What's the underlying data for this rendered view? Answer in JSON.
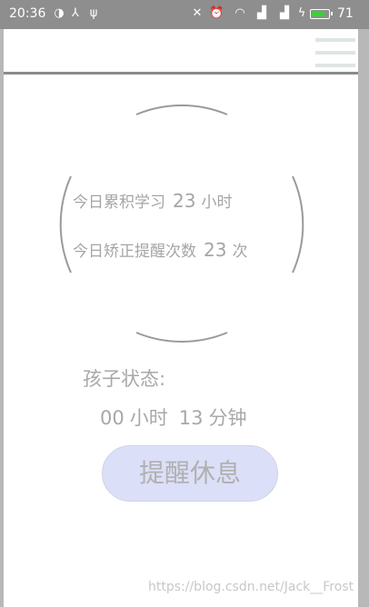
{
  "status_bar": {
    "time": "20:36",
    "battery_level": "71",
    "battery_color": "#38d236"
  },
  "app_bar": {
    "menu_icon": "hamburger-menu-icon"
  },
  "stats": {
    "study_label": "今日累积学习",
    "study_value": "23",
    "study_unit": "小时",
    "correct_label": "今日矫正提醒次数",
    "correct_value": "23",
    "correct_unit": "次"
  },
  "child_status": {
    "label": "孩子状态:",
    "hours": "00",
    "hours_unit": "小时",
    "minutes": "13",
    "minutes_unit": "分钟"
  },
  "button": {
    "label": "提醒休息",
    "color": "#dcdff8"
  },
  "watermark": "https://blog.csdn.net/Jack__Frost"
}
